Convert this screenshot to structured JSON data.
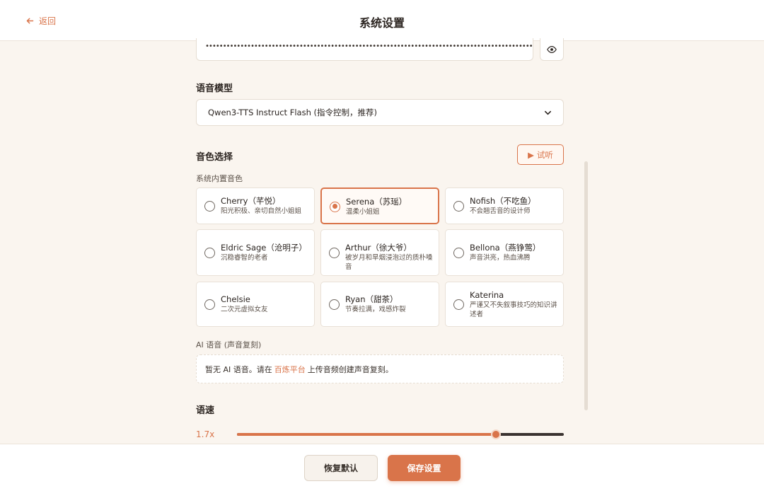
{
  "header": {
    "back_label": "返回",
    "title": "系统设置"
  },
  "api_key": {
    "masked_value": "••••••••••••••••••••••••••••••••••••••••••••••••••••••••••••••••••••••••••••••••••••••••••••••••"
  },
  "voice_model": {
    "label": "语音模型",
    "selected": "Qwen3-TTS Instruct Flash (指令控制，推荐)"
  },
  "voice_select": {
    "label": "音色选择",
    "preview_label": "试听",
    "builtin_label": "系统内置音色",
    "voices": [
      {
        "name": "Cherry（芊悦）",
        "desc": "阳光积极、亲切自然小姐姐",
        "selected": false
      },
      {
        "name": "Serena（苏瑶）",
        "desc": "温柔小姐姐",
        "selected": true
      },
      {
        "name": "Nofish（不吃鱼）",
        "desc": "不会翘舌音的设计师",
        "selected": false
      },
      {
        "name": "Eldric Sage（沧明子）",
        "desc": "沉稳睿智的老者",
        "selected": false
      },
      {
        "name": "Arthur（徐大爷）",
        "desc": "被岁月和旱烟浸泡过的质朴嗓音",
        "selected": false
      },
      {
        "name": "Bellona（燕铮莺）",
        "desc": "声音洪亮，热血沸腾",
        "selected": false
      },
      {
        "name": "Chelsie",
        "desc": "二次元虚拟女友",
        "selected": false
      },
      {
        "name": "Ryan（甜茶）",
        "desc": "节奏拉满，戏感炸裂",
        "selected": false
      },
      {
        "name": "Katerina",
        "desc": "严谨又不失叙事技巧的知识讲述者",
        "selected": false
      }
    ],
    "ai_label": "AI 语音 (声音复刻)",
    "ai_empty_prefix": "暂无 AI 语音。请在",
    "ai_empty_link": "百炼平台",
    "ai_empty_suffix": "上传音频创建声音复刻。"
  },
  "speed": {
    "label": "语速",
    "value_text": "1.7x",
    "fraction": 0.792
  },
  "footer": {
    "reset_label": "恢复默认",
    "save_label": "保存设置"
  },
  "colors": {
    "accent": "#d9744a",
    "background": "#faf5ef"
  }
}
